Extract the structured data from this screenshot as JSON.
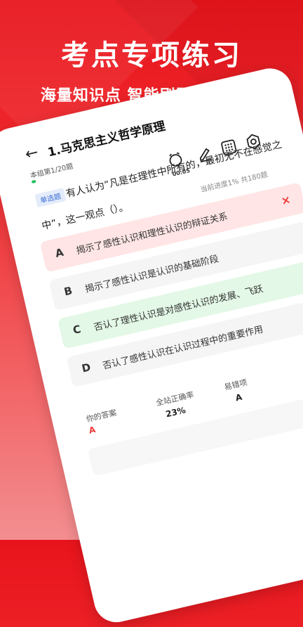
{
  "hero": {
    "title": "考点专项练习",
    "subtitle": "海量知识点 智能刷题 练练不忘"
  },
  "quiz": {
    "back_icon": "back-arrow-icon",
    "title": "1.马克思主义哲学原理",
    "group_progress": "本组第1/20题",
    "timer": "00:05",
    "current_progress": "当前进度1% 共180题",
    "question_type": "单选题",
    "question_text_line1": "有人认为“凡是在理性中所有的，最初无不在感觉之",
    "question_text_line2": "中”，这一观点（）。",
    "options": [
      {
        "letter": "A",
        "text": "揭示了感性认识和理性认识的辩证关系",
        "state": "wrong"
      },
      {
        "letter": "B",
        "text": "揭示了感性认识是认识的基础阶段",
        "state": "normal"
      },
      {
        "letter": "C",
        "text": "否认了理性认识是对感性认识的发展、飞跃",
        "state": "correct"
      },
      {
        "letter": "D",
        "text": "否认了感性认识在认识过程中的重要作用",
        "state": "normal"
      }
    ],
    "your_answer_label": "你的答案",
    "your_answer_value": "A",
    "accuracy_label": "全站正确率",
    "accuracy_value": "23%",
    "easy_wrong_label": "易错项",
    "easy_wrong_value": "A",
    "wrong_mark": "×"
  },
  "colors": {
    "brand_red": "#e8141c",
    "correct_green": "#e3f8e6",
    "wrong_red": "#ffe5e5"
  }
}
